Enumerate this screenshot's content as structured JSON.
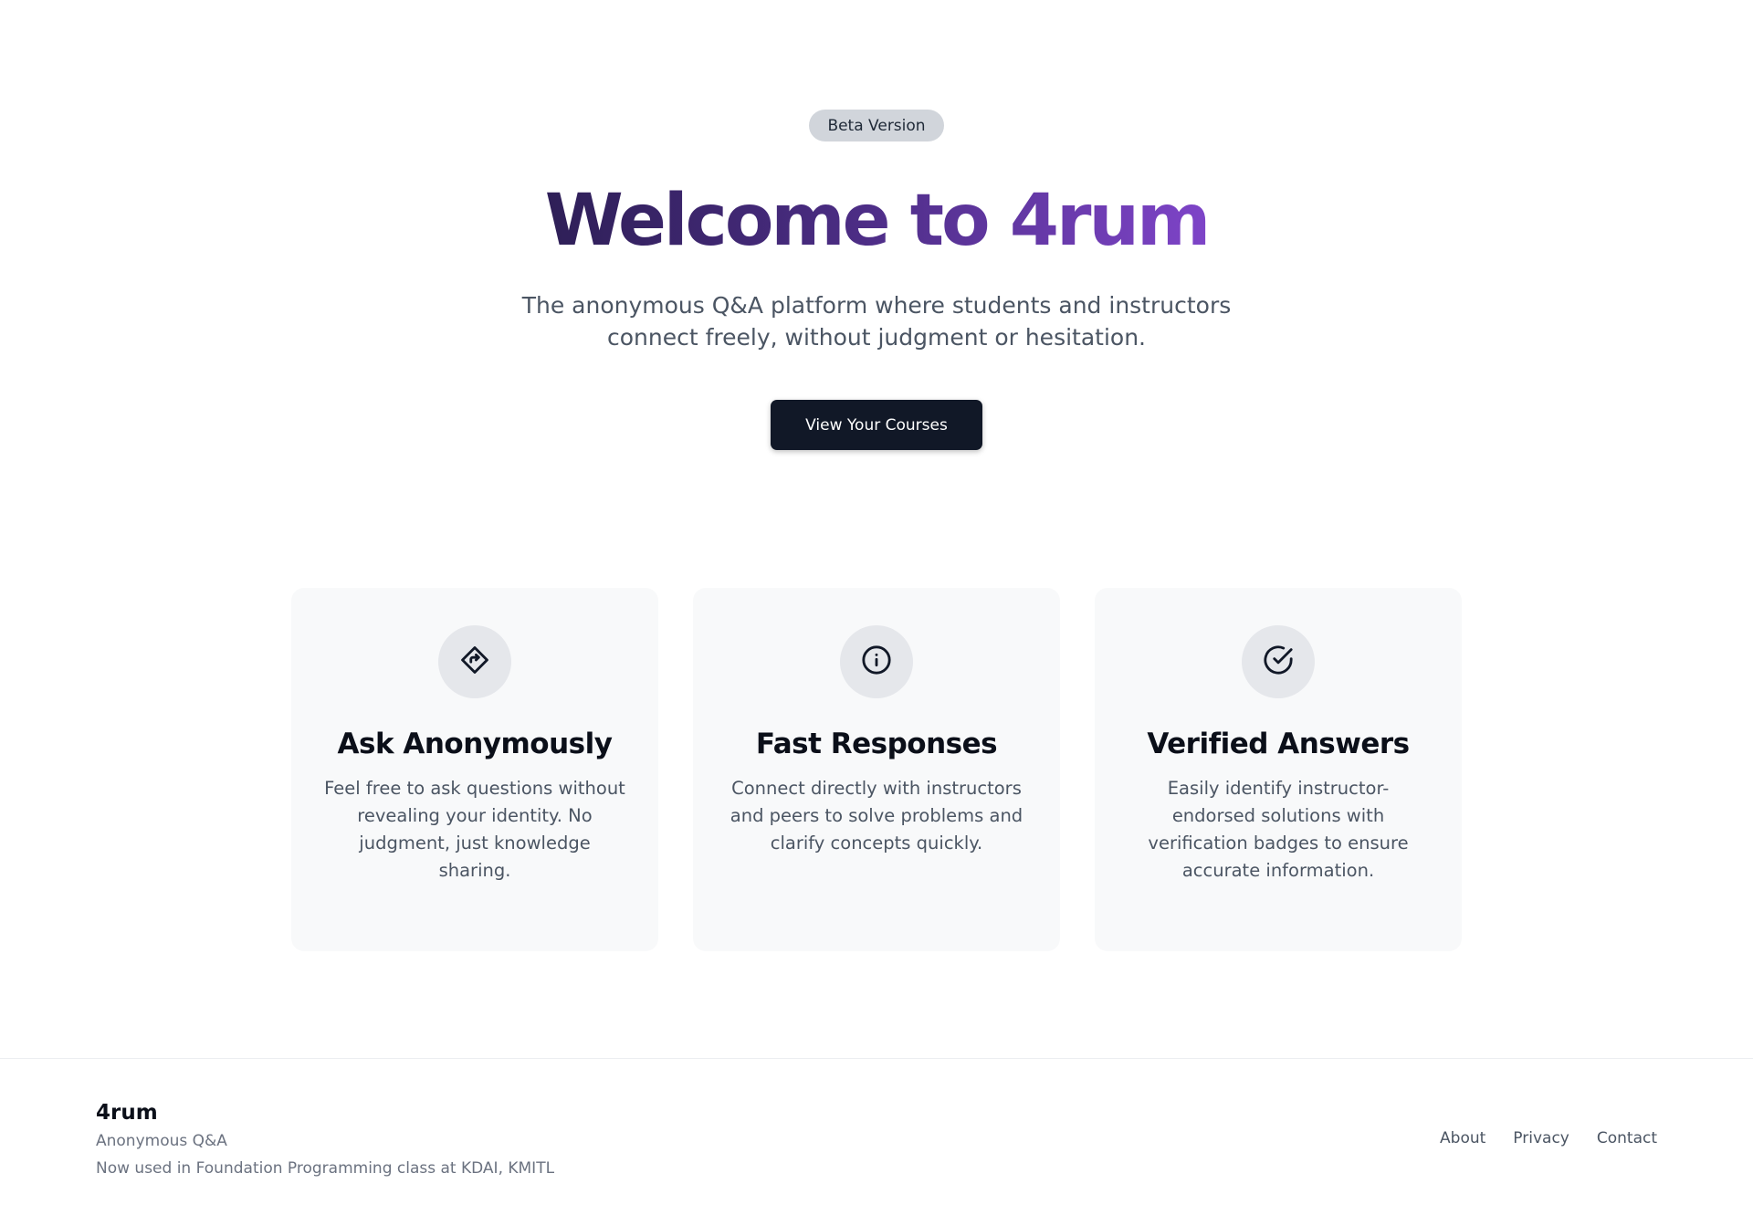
{
  "hero": {
    "badge": "Beta Version",
    "title": "Welcome to 4rum",
    "subtitle": "The anonymous Q&A platform where students and instructors connect freely, without judgment or hesitation.",
    "cta_label": "View Your Courses"
  },
  "features": [
    {
      "icon": "diamond-arrow-icon",
      "title": "Ask Anonymously",
      "text": "Feel free to ask questions without revealing your identity. No judgment, just knowledge sharing."
    },
    {
      "icon": "info-icon",
      "title": "Fast Responses",
      "text": "Connect directly with instructors and peers to solve problems and clarify concepts quickly."
    },
    {
      "icon": "check-circle-icon",
      "title": "Verified Answers",
      "text": "Easily identify instructor-endorsed solutions with verification badges to ensure accurate information."
    }
  ],
  "footer": {
    "brand": "4rum",
    "tagline": "Anonymous Q&A",
    "note": "Now used in Foundation Programming class at KDAI, KMITL",
    "links": [
      "About",
      "Privacy",
      "Contact"
    ]
  },
  "colors": {
    "title_gradient_start": "#2e1f57",
    "title_gradient_end": "#7e44c8",
    "button_bg": "#111827",
    "card_bg": "#f8f9fa",
    "badge_bg": "#d1d5db"
  }
}
